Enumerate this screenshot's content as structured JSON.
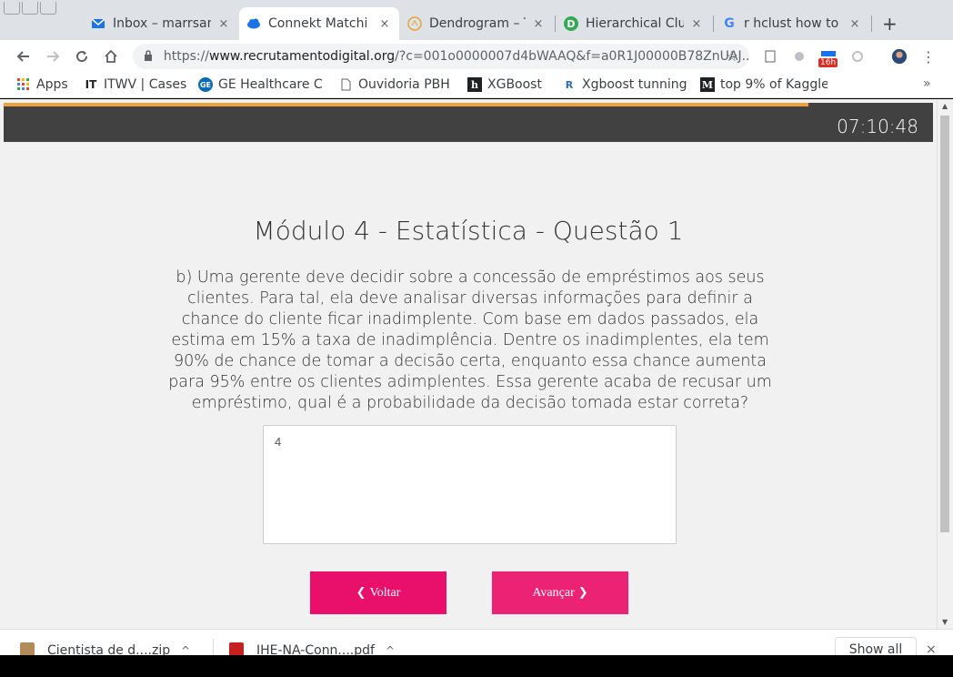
{
  "browser": {
    "tabs": [
      {
        "title": "Inbox – marrsan",
        "close": "×",
        "favicon": "mail-icon",
        "color": "#1a73e8"
      },
      {
        "title": "Connekt Matchi",
        "close": "×",
        "favicon": "cloud-icon",
        "color": "#1a73e8",
        "active": true
      },
      {
        "title": "Dendrogram – T",
        "close": "×",
        "favicon": "dendrogram-icon",
        "color": "#e8a33a"
      },
      {
        "title": "Hierarchical Clu",
        "close": "×",
        "favicon": "d-logo-icon",
        "color": "#34a853"
      },
      {
        "title": "r hclust how to",
        "close": "×",
        "favicon": "google-icon",
        "color": "#4285f4"
      }
    ],
    "new_tab": "+",
    "url": {
      "scheme": "https://",
      "host": "www.recrutamentodigital.org",
      "rest": "/?c=001o0000007d4bWAAQ&f=a0R1J00000B78ZnUAJ..."
    },
    "extension_badge": "16h",
    "bookmarks": [
      {
        "label": "Apps",
        "icon": "apps-grid-icon"
      },
      {
        "label": "ITWV | Cases",
        "icon": "itwv-icon"
      },
      {
        "label": "GE Healthcare C",
        "icon": "ge-logo-icon"
      },
      {
        "label": "Ouvidoria PBH",
        "icon": "page-icon"
      },
      {
        "label": "XGBoost",
        "icon": "h-logo-icon"
      },
      {
        "label": "Xgboost tunning",
        "icon": "r-logo-icon"
      },
      {
        "label": "top 9% of Kaggle",
        "icon": "m-logo-icon"
      }
    ],
    "bookmarks_more": "»"
  },
  "page": {
    "timer": "07:10:48",
    "progress_fraction": 0.866,
    "title": "Módulo 4 - Estatística - Questão 1",
    "question": "b) Uma gerente deve decidir sobre a concessão de empréstimos aos seus clientes. Para tal, ela deve analisar diversas informações para definir a chance do cliente ficar inadimplente. Com base em dados passados, ela estima em 15% a taxa de inadimplência. Dentre os inadimplentes, ela tem 90% de chance de tomar a decisão certa, enquanto essa chance aumenta para 95% entre os clientes adimplentes. Essa gerente acaba de recusar um empréstimo, qual é a probabilidade da decisão tomada estar correta?",
    "answer_value": "4",
    "back_label": "Voltar",
    "next_label": "Avançar",
    "accent_color": "#e8106a"
  },
  "downloads": {
    "items": [
      {
        "label": "Cientista de d....zip",
        "caret": "^",
        "icon": "zip-icon"
      },
      {
        "label": "IHE-NA-Conn....pdf",
        "caret": "^",
        "icon": "pdf-icon"
      }
    ],
    "show_all": "Show all",
    "close": "×"
  }
}
